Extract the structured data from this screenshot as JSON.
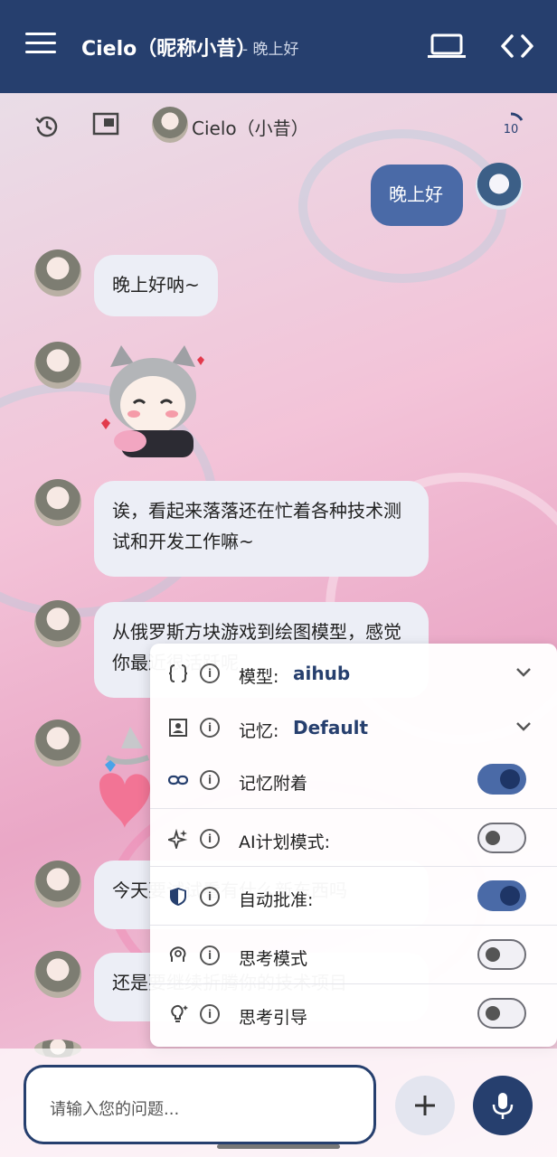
{
  "header": {
    "title": "Cielo（昵称小昔）",
    "subtitle": "- 晚上好",
    "bg_color": "#263f6e"
  },
  "subbar": {
    "character_name": "Cielo（小昔）",
    "counter": "10"
  },
  "messages": [
    {
      "role": "user",
      "text": "晚上好"
    },
    {
      "role": "assistant",
      "text": "晚上好呐~"
    },
    {
      "role": "assistant",
      "type": "sticker"
    },
    {
      "role": "assistant",
      "text": "诶，看起来落落还在忙着各种技术测试和开发工作嘛~"
    },
    {
      "role": "assistant",
      "text": "从俄罗斯方块游戏到绘图模型，感觉你最近很活跃呢"
    },
    {
      "role": "assistant",
      "type": "sticker"
    },
    {
      "role": "assistant",
      "text": "今天要试试看有什么新东西吗"
    },
    {
      "role": "assistant",
      "text": "还是要继续折腾你的技术项目"
    }
  ],
  "popup": {
    "model_label": "模型:",
    "model_value": "aihub",
    "memory_label": "记忆:",
    "memory_value": "Default",
    "memory_attach_label": "记忆附着",
    "memory_attach_on": true,
    "ai_plan_label": "AI计划模式:",
    "ai_plan_on": false,
    "auto_approve_label": "自动批准:",
    "auto_approve_on": true,
    "thinking_label": "思考模式",
    "thinking_on": false,
    "thinking_guide_label": "思考引导",
    "thinking_guide_on": false
  },
  "composer": {
    "placeholder": "请输入您的问题..."
  },
  "colors": {
    "primary": "#263f6e",
    "user_bubble": "#4a6aa7",
    "assistant_bubble": "#eceef6"
  }
}
